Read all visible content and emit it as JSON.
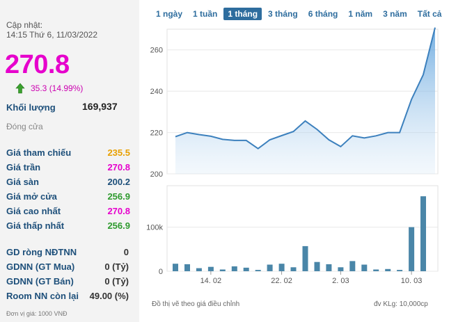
{
  "quote": {
    "update_label": "Cập nhật:",
    "update_time": "14:15 Thứ 6, 11/03/2022",
    "price": "270.8",
    "change": "35.3 (14.99%)",
    "volume_label": "Khối lượng",
    "volume_value": "169,937",
    "close_label": "Đóng cửa"
  },
  "price_rows": [
    {
      "label": "Giá tham chiếu",
      "value": "235.5",
      "color": "#e8a000"
    },
    {
      "label": "Giá trần",
      "value": "270.8",
      "color": "#e600cc"
    },
    {
      "label": "Giá sàn",
      "value": "200.2",
      "color": "#1d4f7a"
    },
    {
      "label": "Giá mở cửa",
      "value": "256.9",
      "color": "#2e9a2e"
    },
    {
      "label": "Giá cao nhất",
      "value": "270.8",
      "color": "#e600cc"
    },
    {
      "label": "Giá thấp nhất",
      "value": "256.9",
      "color": "#2e9a2e"
    }
  ],
  "foreign_rows": [
    {
      "label": "GD ròng NĐTNN",
      "value": "0"
    },
    {
      "label": "GDNN (GT Mua)",
      "value": "0 (Tỷ)"
    },
    {
      "label": "GDNN (GT Bán)",
      "value": "0 (Tỷ)"
    },
    {
      "label": "Room NN còn lại",
      "value": "49.00 (%)"
    }
  ],
  "unit_note": "Đơn vị giá: 1000 VNĐ",
  "tabs": [
    "1 ngày",
    "1 tuần",
    "1 tháng",
    "3 tháng",
    "6 tháng",
    "1 năm",
    "3 năm",
    "Tất cả"
  ],
  "active_tab": "1 tháng",
  "chart_note_left": "Đồ thị vẽ theo giá điều chỉnh",
  "chart_note_right": "đv KLg: 10,000cp",
  "chart_data": [
    {
      "type": "area",
      "x": [
        "09/02",
        "10/02",
        "11/02",
        "14/02",
        "15/02",
        "16/02",
        "17/02",
        "18/02",
        "21/02",
        "22/02",
        "23/02",
        "24/02",
        "25/02",
        "28/02",
        "01/03",
        "02/03",
        "03/03",
        "04/03",
        "07/03",
        "08/03",
        "09/03",
        "10/03",
        "11/03"
      ],
      "values": [
        218,
        220,
        219,
        218.2,
        216.7,
        216.2,
        216.2,
        212.2,
        216.5,
        218.5,
        220.5,
        225.6,
        221.5,
        216.5,
        213.2,
        218.4,
        217.4,
        218.4,
        220,
        220,
        236,
        248,
        270.8
      ],
      "ylim": [
        200,
        270
      ],
      "yticks": [
        200,
        220,
        240,
        260
      ],
      "grid": true
    },
    {
      "type": "bar",
      "x": [
        "09/02",
        "10/02",
        "11/02",
        "14/02",
        "15/02",
        "16/02",
        "17/02",
        "18/02",
        "21/02",
        "22/02",
        "23/02",
        "24/02",
        "25/02",
        "28/02",
        "01/03",
        "02/03",
        "03/03",
        "04/03",
        "07/03",
        "08/03",
        "09/03",
        "10/03",
        "11/03"
      ],
      "values": [
        17000,
        16000,
        7000,
        10000,
        4000,
        11000,
        8000,
        3000,
        15000,
        17000,
        9000,
        57000,
        21000,
        16000,
        9000,
        23000,
        15000,
        4000,
        5000,
        3000,
        100000,
        170000,
        0
      ],
      "xticks": [
        "14. 02",
        "22. 02",
        "2. 03",
        "10. 03"
      ],
      "yticks": [
        "0",
        "100k"
      ],
      "grid": true
    }
  ]
}
